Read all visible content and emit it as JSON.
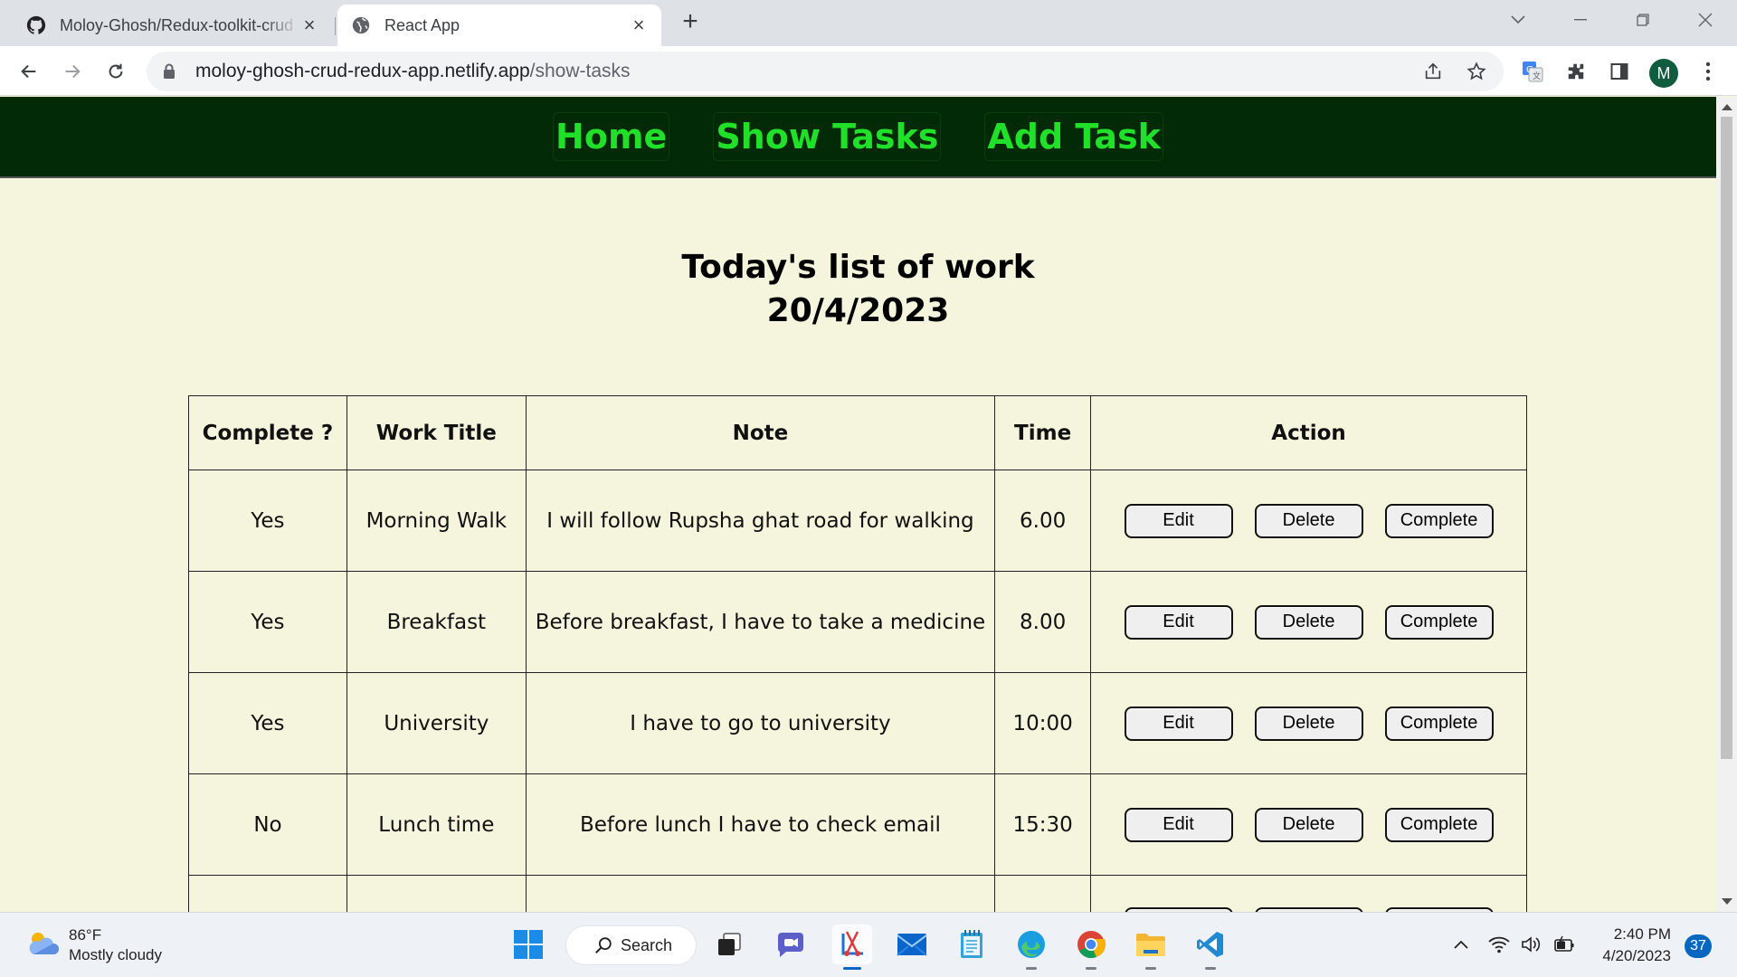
{
  "browser": {
    "tabs": [
      {
        "title": "Moloy-Ghosh/Redux-toolkit-crud",
        "icon": "github-icon",
        "active": false
      },
      {
        "title": "React App",
        "icon": "globe-icon",
        "active": true
      }
    ],
    "url_host": "moloy-ghosh-crud-redux-app.netlify.app",
    "url_path": "/show-tasks",
    "profile_initial": "M"
  },
  "site": {
    "nav": {
      "home": "Home",
      "show_tasks": "Show Tasks",
      "add_task": "Add Task"
    },
    "heading_line1": "Today's list of work",
    "heading_line2": "20/4/2023",
    "table": {
      "headers": {
        "complete": "Complete ?",
        "title": "Work Title",
        "note": "Note",
        "time": "Time",
        "action": "Action"
      },
      "rows": [
        {
          "complete": "Yes",
          "title": "Morning Walk",
          "note": "I will follow Rupsha ghat road for walking",
          "time": "6.00"
        },
        {
          "complete": "Yes",
          "title": "Breakfast",
          "note": "Before breakfast, I have to take a medicine",
          "time": "8.00"
        },
        {
          "complete": "Yes",
          "title": "University",
          "note": "I have to go to university",
          "time": "10:00"
        },
        {
          "complete": "No",
          "title": "Lunch time",
          "note": "Before lunch I have to check email",
          "time": "15:30"
        }
      ],
      "actions": {
        "edit": "Edit",
        "delete": "Delete",
        "complete": "Complete"
      }
    }
  },
  "taskbar": {
    "weather_temp": "86°F",
    "weather_desc": "Mostly cloudy",
    "search_label": "Search",
    "time": "2:40 PM",
    "date": "4/20/2023",
    "notification_count": "37"
  },
  "colors": {
    "nav_background": "#032a06",
    "nav_link": "#21e02a",
    "page_background": "#f5f4dc"
  }
}
